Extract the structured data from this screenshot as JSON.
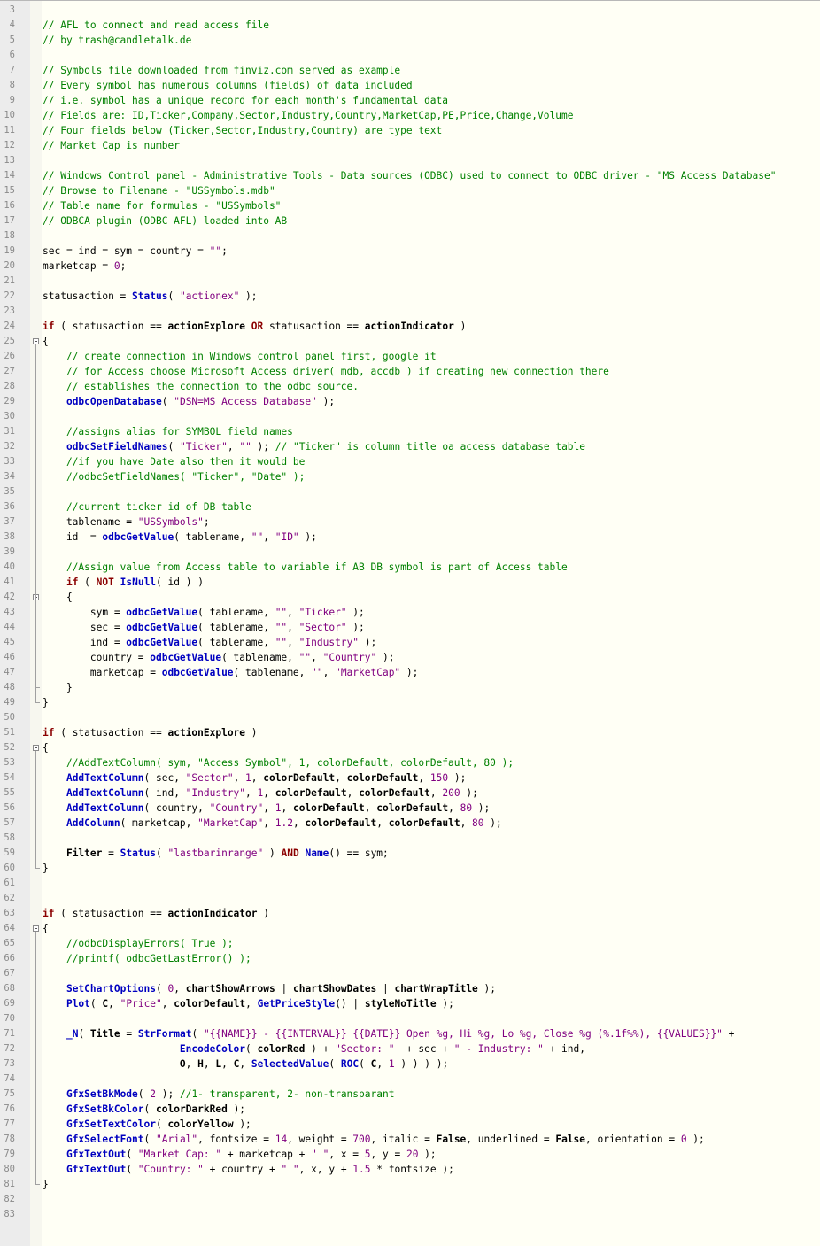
{
  "editor": {
    "first_line_number": 3,
    "lines": [
      [],
      [
        [
          "c",
          "// AFL to connect and read access file"
        ]
      ],
      [
        [
          "c",
          "// by trash@candletalk.de"
        ]
      ],
      [],
      [
        [
          "c",
          "// Symbols file downloaded from finviz.com served as example"
        ]
      ],
      [
        [
          "c",
          "// Every symbol has numerous columns (fields) of data included"
        ]
      ],
      [
        [
          "c",
          "// i.e. symbol has a unique record for each month's fundamental data"
        ]
      ],
      [
        [
          "c",
          "// Fields are: ID,Ticker,Company,Sector,Industry,Country,MarketCap,PE,Price,Change,Volume"
        ]
      ],
      [
        [
          "c",
          "// Four fields below (Ticker,Sector,Industry,Country) are type text"
        ]
      ],
      [
        [
          "c",
          "// Market Cap is number"
        ]
      ],
      [],
      [
        [
          "c",
          "// Windows Control panel - Administrative Tools - Data sources (ODBC) used to connect to ODBC driver - \"MS Access Database\""
        ]
      ],
      [
        [
          "c",
          "// Browse to Filename - \"USSymbols.mdb\""
        ]
      ],
      [
        [
          "c",
          "// Table name for formulas - \"USSymbols\""
        ]
      ],
      [
        [
          "c",
          "// ODBCA plugin (ODBC AFL) loaded into AB"
        ]
      ],
      [],
      [
        [
          "t",
          "sec = ind = sym = country = "
        ],
        [
          "s",
          "\"\""
        ],
        [
          "t",
          ";"
        ]
      ],
      [
        [
          "t",
          "marketcap = "
        ],
        [
          "n",
          "0"
        ],
        [
          "t",
          ";"
        ]
      ],
      [],
      [
        [
          "t",
          "statusaction = "
        ],
        [
          "f",
          "Status"
        ],
        [
          "t",
          "( "
        ],
        [
          "s",
          "\"actionex\""
        ],
        [
          "t",
          " );"
        ]
      ],
      [],
      [
        [
          "k",
          "if"
        ],
        [
          "t",
          " ( statusaction == "
        ],
        [
          "v",
          "actionExplore"
        ],
        [
          "t",
          " "
        ],
        [
          "k",
          "OR"
        ],
        [
          "t",
          " statusaction == "
        ],
        [
          "v",
          "actionIndicator"
        ],
        [
          "t",
          " )"
        ]
      ],
      [
        [
          "t",
          "{"
        ]
      ],
      [
        [
          "t",
          "    "
        ],
        [
          "c",
          "// create connection in Windows control panel first, google it"
        ]
      ],
      [
        [
          "t",
          "    "
        ],
        [
          "c",
          "// for Access choose Microsoft Access driver( mdb, accdb ) if creating new connection there"
        ]
      ],
      [
        [
          "t",
          "    "
        ],
        [
          "c",
          "// establishes the connection to the odbc source."
        ]
      ],
      [
        [
          "t",
          "    "
        ],
        [
          "f",
          "odbcOpenDatabase"
        ],
        [
          "t",
          "( "
        ],
        [
          "s",
          "\"DSN=MS Access Database\""
        ],
        [
          "t",
          " );"
        ]
      ],
      [],
      [
        [
          "t",
          "    "
        ],
        [
          "c",
          "//assigns alias for SYMBOL field names"
        ]
      ],
      [
        [
          "t",
          "    "
        ],
        [
          "f",
          "odbcSetFieldNames"
        ],
        [
          "t",
          "( "
        ],
        [
          "s",
          "\"Ticker\""
        ],
        [
          "t",
          ", "
        ],
        [
          "s",
          "\"\""
        ],
        [
          "t",
          " ); "
        ],
        [
          "c",
          "// \"Ticker\" is column title oa access database table"
        ]
      ],
      [
        [
          "t",
          "    "
        ],
        [
          "c",
          "//if you have Date also then it would be"
        ]
      ],
      [
        [
          "t",
          "    "
        ],
        [
          "c",
          "//odbcSetFieldNames( \"Ticker\", \"Date\" );"
        ]
      ],
      [],
      [
        [
          "t",
          "    "
        ],
        [
          "c",
          "//current ticker id of DB table"
        ]
      ],
      [
        [
          "t",
          "    tablename = "
        ],
        [
          "s",
          "\"USSymbols\""
        ],
        [
          "t",
          ";"
        ]
      ],
      [
        [
          "t",
          "    id  = "
        ],
        [
          "f",
          "odbcGetValue"
        ],
        [
          "t",
          "( tablename, "
        ],
        [
          "s",
          "\"\""
        ],
        [
          "t",
          ", "
        ],
        [
          "s",
          "\"ID\""
        ],
        [
          "t",
          " );"
        ]
      ],
      [],
      [
        [
          "t",
          "    "
        ],
        [
          "c",
          "//Assign value from Access table to variable if AB DB symbol is part of Access table"
        ]
      ],
      [
        [
          "t",
          "    "
        ],
        [
          "k",
          "if"
        ],
        [
          "t",
          " ( "
        ],
        [
          "k",
          "NOT"
        ],
        [
          "t",
          " "
        ],
        [
          "f",
          "IsNull"
        ],
        [
          "t",
          "( id ) )"
        ]
      ],
      [
        [
          "t",
          "    {"
        ]
      ],
      [
        [
          "t",
          "        sym = "
        ],
        [
          "f",
          "odbcGetValue"
        ],
        [
          "t",
          "( tablename, "
        ],
        [
          "s",
          "\"\""
        ],
        [
          "t",
          ", "
        ],
        [
          "s",
          "\"Ticker\""
        ],
        [
          "t",
          " );"
        ]
      ],
      [
        [
          "t",
          "        sec = "
        ],
        [
          "f",
          "odbcGetValue"
        ],
        [
          "t",
          "( tablename, "
        ],
        [
          "s",
          "\"\""
        ],
        [
          "t",
          ", "
        ],
        [
          "s",
          "\"Sector\""
        ],
        [
          "t",
          " );"
        ]
      ],
      [
        [
          "t",
          "        ind = "
        ],
        [
          "f",
          "odbcGetValue"
        ],
        [
          "t",
          "( tablename, "
        ],
        [
          "s",
          "\"\""
        ],
        [
          "t",
          ", "
        ],
        [
          "s",
          "\"Industry\""
        ],
        [
          "t",
          " );"
        ]
      ],
      [
        [
          "t",
          "        country = "
        ],
        [
          "f",
          "odbcGetValue"
        ],
        [
          "t",
          "( tablename, "
        ],
        [
          "s",
          "\"\""
        ],
        [
          "t",
          ", "
        ],
        [
          "s",
          "\"Country\""
        ],
        [
          "t",
          " );"
        ]
      ],
      [
        [
          "t",
          "        marketcap = "
        ],
        [
          "f",
          "odbcGetValue"
        ],
        [
          "t",
          "( tablename, "
        ],
        [
          "s",
          "\"\""
        ],
        [
          "t",
          ", "
        ],
        [
          "s",
          "\"MarketCap\""
        ],
        [
          "t",
          " );"
        ]
      ],
      [
        [
          "t",
          "    }"
        ]
      ],
      [
        [
          "t",
          "}"
        ]
      ],
      [],
      [
        [
          "k",
          "if"
        ],
        [
          "t",
          " ( statusaction == "
        ],
        [
          "v",
          "actionExplore"
        ],
        [
          "t",
          " )"
        ]
      ],
      [
        [
          "t",
          "{"
        ]
      ],
      [
        [
          "t",
          "    "
        ],
        [
          "c",
          "//AddTextColumn( sym, \"Access Symbol\", 1, colorDefault, colorDefault, 80 );"
        ]
      ],
      [
        [
          "t",
          "    "
        ],
        [
          "f",
          "AddTextColumn"
        ],
        [
          "t",
          "( sec, "
        ],
        [
          "s",
          "\"Sector\""
        ],
        [
          "t",
          ", "
        ],
        [
          "n",
          "1"
        ],
        [
          "t",
          ", "
        ],
        [
          "v",
          "colorDefault"
        ],
        [
          "t",
          ", "
        ],
        [
          "v",
          "colorDefault"
        ],
        [
          "t",
          ", "
        ],
        [
          "n",
          "150"
        ],
        [
          "t",
          " );"
        ]
      ],
      [
        [
          "t",
          "    "
        ],
        [
          "f",
          "AddTextColumn"
        ],
        [
          "t",
          "( ind, "
        ],
        [
          "s",
          "\"Industry\""
        ],
        [
          "t",
          ", "
        ],
        [
          "n",
          "1"
        ],
        [
          "t",
          ", "
        ],
        [
          "v",
          "colorDefault"
        ],
        [
          "t",
          ", "
        ],
        [
          "v",
          "colorDefault"
        ],
        [
          "t",
          ", "
        ],
        [
          "n",
          "200"
        ],
        [
          "t",
          " );"
        ]
      ],
      [
        [
          "t",
          "    "
        ],
        [
          "f",
          "AddTextColumn"
        ],
        [
          "t",
          "( country, "
        ],
        [
          "s",
          "\"Country\""
        ],
        [
          "t",
          ", "
        ],
        [
          "n",
          "1"
        ],
        [
          "t",
          ", "
        ],
        [
          "v",
          "colorDefault"
        ],
        [
          "t",
          ", "
        ],
        [
          "v",
          "colorDefault"
        ],
        [
          "t",
          ", "
        ],
        [
          "n",
          "80"
        ],
        [
          "t",
          " );"
        ]
      ],
      [
        [
          "t",
          "    "
        ],
        [
          "f",
          "AddColumn"
        ],
        [
          "t",
          "( marketcap, "
        ],
        [
          "s",
          "\"MarketCap\""
        ],
        [
          "t",
          ", "
        ],
        [
          "n",
          "1.2"
        ],
        [
          "t",
          ", "
        ],
        [
          "v",
          "colorDefault"
        ],
        [
          "t",
          ", "
        ],
        [
          "v",
          "colorDefault"
        ],
        [
          "t",
          ", "
        ],
        [
          "n",
          "80"
        ],
        [
          "t",
          " );"
        ]
      ],
      [],
      [
        [
          "t",
          "    "
        ],
        [
          "v",
          "Filter"
        ],
        [
          "t",
          " = "
        ],
        [
          "f",
          "Status"
        ],
        [
          "t",
          "( "
        ],
        [
          "s",
          "\"lastbarinrange\""
        ],
        [
          "t",
          " ) "
        ],
        [
          "k",
          "AND"
        ],
        [
          "t",
          " "
        ],
        [
          "f",
          "Name"
        ],
        [
          "t",
          "() == sym;"
        ]
      ],
      [
        [
          "t",
          "}"
        ]
      ],
      [],
      [],
      [
        [
          "k",
          "if"
        ],
        [
          "t",
          " ( statusaction == "
        ],
        [
          "v",
          "actionIndicator"
        ],
        [
          "t",
          " )"
        ]
      ],
      [
        [
          "t",
          "{"
        ]
      ],
      [
        [
          "t",
          "    "
        ],
        [
          "c",
          "//odbcDisplayErrors( True );"
        ]
      ],
      [
        [
          "t",
          "    "
        ],
        [
          "c",
          "//printf( odbcGetLastError() );"
        ]
      ],
      [],
      [
        [
          "t",
          "    "
        ],
        [
          "f",
          "SetChartOptions"
        ],
        [
          "t",
          "( "
        ],
        [
          "n",
          "0"
        ],
        [
          "t",
          ", "
        ],
        [
          "v",
          "chartShowArrows"
        ],
        [
          "t",
          " | "
        ],
        [
          "v",
          "chartShowDates"
        ],
        [
          "t",
          " | "
        ],
        [
          "v",
          "chartWrapTitle"
        ],
        [
          "t",
          " );"
        ]
      ],
      [
        [
          "t",
          "    "
        ],
        [
          "f",
          "Plot"
        ],
        [
          "t",
          "( "
        ],
        [
          "v",
          "C"
        ],
        [
          "t",
          ", "
        ],
        [
          "s",
          "\"Price\""
        ],
        [
          "t",
          ", "
        ],
        [
          "v",
          "colorDefault"
        ],
        [
          "t",
          ", "
        ],
        [
          "f",
          "GetPriceStyle"
        ],
        [
          "t",
          "() | "
        ],
        [
          "v",
          "styleNoTitle"
        ],
        [
          "t",
          " );"
        ]
      ],
      [],
      [
        [
          "t",
          "    "
        ],
        [
          "f",
          "_N"
        ],
        [
          "t",
          "( "
        ],
        [
          "v",
          "Title"
        ],
        [
          "t",
          " = "
        ],
        [
          "f",
          "StrFormat"
        ],
        [
          "t",
          "( "
        ],
        [
          "s",
          "\"{{NAME}} - {{INTERVAL}} {{DATE}} Open %g, Hi %g, Lo %g, Close %g (%.1f%%), {{VALUES}}\""
        ],
        [
          "t",
          " +"
        ]
      ],
      [
        [
          "t",
          "                       "
        ],
        [
          "f",
          "EncodeColor"
        ],
        [
          "t",
          "( "
        ],
        [
          "v",
          "colorRed"
        ],
        [
          "t",
          " ) + "
        ],
        [
          "s",
          "\"Sector: \""
        ],
        [
          "t",
          "  + sec + "
        ],
        [
          "s",
          "\" - Industry: \""
        ],
        [
          "t",
          " + ind,"
        ]
      ],
      [
        [
          "t",
          "                       "
        ],
        [
          "v",
          "O"
        ],
        [
          "t",
          ", "
        ],
        [
          "v",
          "H"
        ],
        [
          "t",
          ", "
        ],
        [
          "v",
          "L"
        ],
        [
          "t",
          ", "
        ],
        [
          "v",
          "C"
        ],
        [
          "t",
          ", "
        ],
        [
          "f",
          "SelectedValue"
        ],
        [
          "t",
          "( "
        ],
        [
          "f",
          "ROC"
        ],
        [
          "t",
          "( "
        ],
        [
          "v",
          "C"
        ],
        [
          "t",
          ", "
        ],
        [
          "n",
          "1"
        ],
        [
          "t",
          " ) ) ) );"
        ]
      ],
      [],
      [
        [
          "t",
          "    "
        ],
        [
          "f",
          "GfxSetBkMode"
        ],
        [
          "t",
          "( "
        ],
        [
          "n",
          "2"
        ],
        [
          "t",
          " ); "
        ],
        [
          "c",
          "//1- transparent, 2- non-transparant"
        ]
      ],
      [
        [
          "t",
          "    "
        ],
        [
          "f",
          "GfxSetBkColor"
        ],
        [
          "t",
          "( "
        ],
        [
          "v",
          "colorDarkRed"
        ],
        [
          "t",
          " );"
        ]
      ],
      [
        [
          "t",
          "    "
        ],
        [
          "f",
          "GfxSetTextColor"
        ],
        [
          "t",
          "( "
        ],
        [
          "v",
          "colorYellow"
        ],
        [
          "t",
          " );"
        ]
      ],
      [
        [
          "t",
          "    "
        ],
        [
          "f",
          "GfxSelectFont"
        ],
        [
          "t",
          "( "
        ],
        [
          "s",
          "\"Arial\""
        ],
        [
          "t",
          ", fontsize = "
        ],
        [
          "n",
          "14"
        ],
        [
          "t",
          ", weight = "
        ],
        [
          "n",
          "700"
        ],
        [
          "t",
          ", italic = "
        ],
        [
          "v",
          "False"
        ],
        [
          "t",
          ", underlined = "
        ],
        [
          "v",
          "False"
        ],
        [
          "t",
          ", orientation = "
        ],
        [
          "n",
          "0"
        ],
        [
          "t",
          " );"
        ]
      ],
      [
        [
          "t",
          "    "
        ],
        [
          "f",
          "GfxTextOut"
        ],
        [
          "t",
          "( "
        ],
        [
          "s",
          "\"Market Cap: \""
        ],
        [
          "t",
          " + marketcap + "
        ],
        [
          "s",
          "\" \""
        ],
        [
          "t",
          ", x = "
        ],
        [
          "n",
          "5"
        ],
        [
          "t",
          ", y = "
        ],
        [
          "n",
          "20"
        ],
        [
          "t",
          " );"
        ]
      ],
      [
        [
          "t",
          "    "
        ],
        [
          "f",
          "GfxTextOut"
        ],
        [
          "t",
          "( "
        ],
        [
          "s",
          "\"Country: \""
        ],
        [
          "t",
          " + country + "
        ],
        [
          "s",
          "\" \""
        ],
        [
          "t",
          ", x, y + "
        ],
        [
          "n",
          "1.5"
        ],
        [
          "t",
          " * fontsize );"
        ]
      ],
      [
        [
          "t",
          "}"
        ]
      ],
      [],
      []
    ]
  }
}
